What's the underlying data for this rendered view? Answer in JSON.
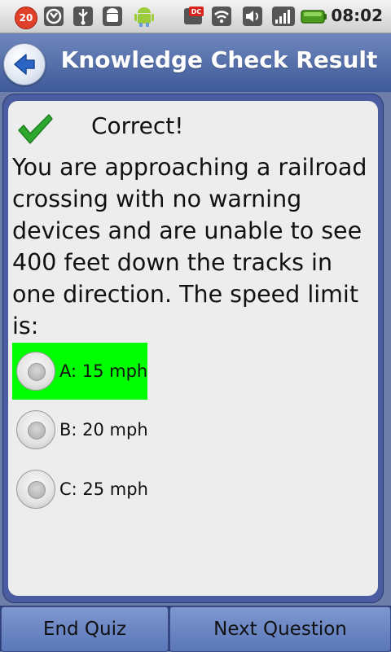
{
  "status_bar": {
    "notification_count": "20",
    "time": "08:02",
    "icons": [
      "notification-badge",
      "bell-icon",
      "usb-icon",
      "android-debug-icon",
      "android-robot-icon",
      "dc-app-icon",
      "wifi-icon",
      "volume-icon",
      "signal-icon",
      "battery-icon"
    ]
  },
  "header": {
    "back_icon": "back-arrow-icon",
    "title": "Knowledge Check Result"
  },
  "result": {
    "icon": "checkmark-icon",
    "label": "Correct!"
  },
  "question": {
    "text": "You are approaching a railroad crossing with no warning devices and are unable to see 400 feet down the tracks in one direction. The speed limit is:"
  },
  "options": [
    {
      "label": "A: 15 mph",
      "selected": true
    },
    {
      "label": "B: 20 mph",
      "selected": false
    },
    {
      "label": "C: 25 mph",
      "selected": false
    }
  ],
  "footer": {
    "end_label": "End Quiz",
    "next_label": "Next Question"
  },
  "colors": {
    "title_bar": "#4f6aa8",
    "selected_highlight": "#00ff00",
    "check_green": "#2fa82f"
  }
}
